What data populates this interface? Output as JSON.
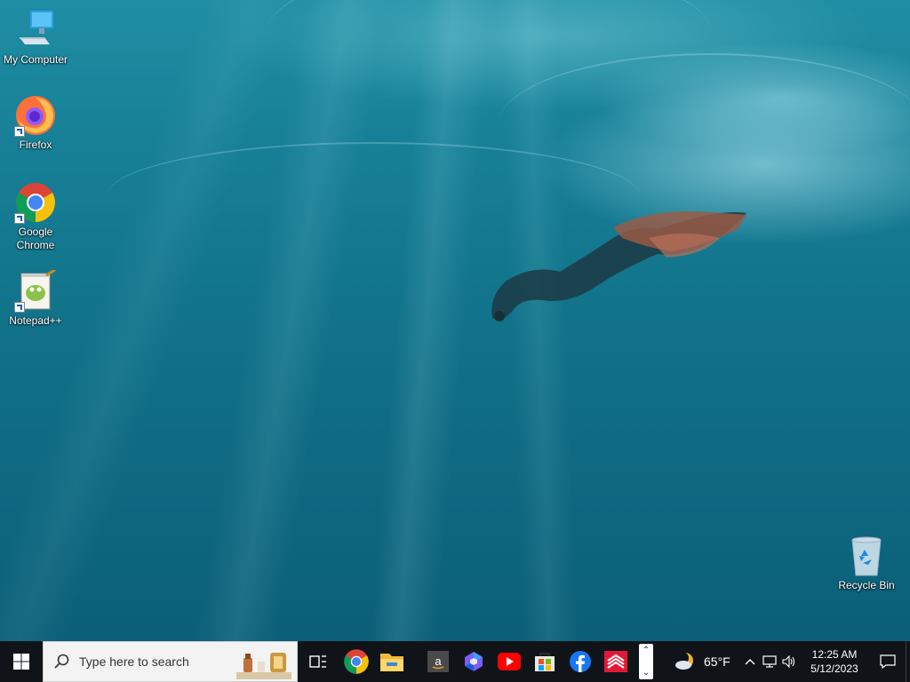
{
  "desktop": {
    "icons": [
      {
        "label": "My Computer"
      },
      {
        "label": "Firefox"
      },
      {
        "label": "Google Chrome"
      },
      {
        "label": "Notepad++"
      },
      {
        "label": "Recycle Bin"
      }
    ]
  },
  "taskbar": {
    "search_placeholder": "Type here to search",
    "pinned_apps": [
      "task-view",
      "google-chrome",
      "file-explorer",
      "amazon",
      "microsoft-365",
      "youtube",
      "microsoft-store",
      "facebook",
      "bank-of-america"
    ],
    "weather": {
      "temperature": "65°F",
      "icon": "moon-cloud-icon"
    },
    "clock": {
      "time": "12:25 AM",
      "date": "5/12/2023"
    }
  },
  "colors": {
    "taskbar_bg": "#101418",
    "water_top": "#1f8ea4",
    "water_bottom": "#0b5f78"
  }
}
